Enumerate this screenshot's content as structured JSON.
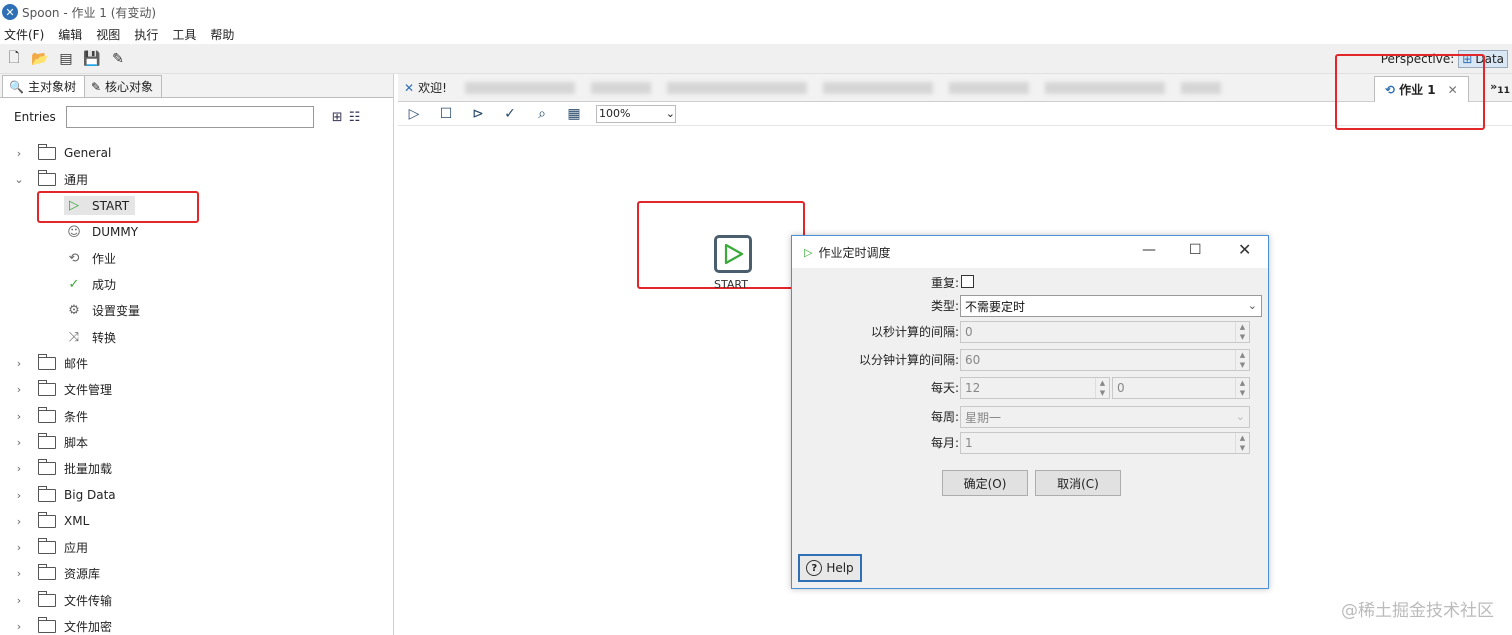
{
  "window": {
    "title": "Spoon - 作业 1 (有变动)"
  },
  "menu": [
    "文件(F)",
    "编辑",
    "视图",
    "执行",
    "工具",
    "帮助"
  ],
  "toolbar": {
    "perspective_label": "Perspective:",
    "perspective_value": "Data"
  },
  "left_panel": {
    "tabs": [
      "主对象树",
      "核心对象"
    ],
    "entries_label": "Entries",
    "entries_value": "",
    "tree": [
      {
        "label": "General",
        "expanded": false
      },
      {
        "label": "通用",
        "expanded": true,
        "children": [
          {
            "label": "START",
            "icon": "play-icon",
            "selected": true
          },
          {
            "label": "DUMMY",
            "icon": "dummy-icon"
          },
          {
            "label": "作业",
            "icon": "job-icon"
          },
          {
            "label": "成功",
            "icon": "check-icon"
          },
          {
            "label": "设置变量",
            "icon": "variable-icon"
          },
          {
            "label": "转换",
            "icon": "transform-icon"
          }
        ]
      },
      {
        "label": "邮件"
      },
      {
        "label": "文件管理"
      },
      {
        "label": "条件"
      },
      {
        "label": "脚本"
      },
      {
        "label": "批量加载"
      },
      {
        "label": "Big Data"
      },
      {
        "label": "XML"
      },
      {
        "label": "应用"
      },
      {
        "label": "资源库"
      },
      {
        "label": "文件传输"
      },
      {
        "label": "文件加密"
      }
    ]
  },
  "editor": {
    "tabs": [
      {
        "label": "欢迎!",
        "icon": "welcome-icon"
      },
      {
        "label": "作业 1",
        "icon": "job-icon",
        "active": true
      }
    ],
    "more_tabs_count": "11",
    "zoom": "100%",
    "node_label": "START"
  },
  "dialog": {
    "title": "作业定时调度",
    "fields": {
      "repeat_label": "重复:",
      "repeat_checked": false,
      "type_label": "类型:",
      "type_value": "不需要定时",
      "seconds_label": "以秒计算的间隔:",
      "seconds_value": "0",
      "minutes_label": "以分钟计算的间隔:",
      "minutes_value": "60",
      "daily_label": "每天:",
      "daily_hour": "12",
      "daily_minute": "0",
      "weekly_label": "每周:",
      "weekly_value": "星期一",
      "monthly_label": "每月:",
      "monthly_value": "1"
    },
    "ok_label": "确定(O)",
    "cancel_label": "取消(C)",
    "help_label": "Help"
  },
  "watermark": "@稀土掘金技术社区"
}
